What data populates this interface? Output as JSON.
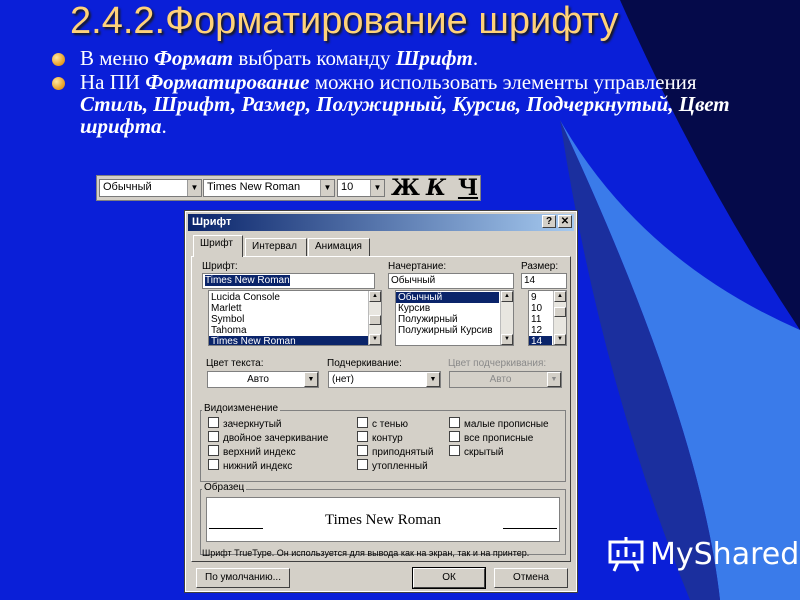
{
  "slide": {
    "title": "2.4.2.Форматирование шрифту",
    "bullet1": {
      "t1": "В меню ",
      "b1": "Формат",
      "t2": " выбрать команду ",
      "b2": "Шрифт",
      "t3": "."
    },
    "bullet2": {
      "t1": "На ПИ ",
      "b1": "Форматирование",
      "t2": " можно использовать элементы управления ",
      "b2": "Стиль, Шрифт, Размер, Полужирный, Курсив, Подчеркнутый, Цвет шрифта",
      "t3": "."
    }
  },
  "toolbar": {
    "style": "Обычный",
    "font": "Times New Roman",
    "size": "10",
    "bold": "Ж",
    "italic": "К",
    "underline": "Ч"
  },
  "dialog": {
    "title": "Шрифт",
    "help": "?",
    "close": "✕",
    "tabs": [
      "Шрифт",
      "Интервал",
      "Анимация"
    ],
    "font_label": "Шрифт:",
    "font_value": "Times New Roman",
    "font_list": [
      "Lucida Console",
      "Marlett",
      "Symbol",
      "Tahoma",
      "Times New Roman"
    ],
    "style_label": "Начертание:",
    "style_value": "Обычный",
    "style_list": [
      "Обычный",
      "Курсив",
      "Полужирный",
      "Полужирный Курсив"
    ],
    "size_label": "Размер:",
    "size_value": "14",
    "size_list": [
      "9",
      "10",
      "11",
      "12",
      "14"
    ],
    "color_label": "Цвет текста:",
    "color_value": "Авто",
    "underline_label": "Подчеркивание:",
    "underline_value": "(нет)",
    "ucolor_label": "Цвет подчеркивания:",
    "ucolor_value": "Авто",
    "effects_label": "Видоизменение",
    "effects_col1": [
      "зачеркнутый",
      "двойное зачеркивание",
      "верхний индекс",
      "нижний индекс"
    ],
    "effects_col2": [
      "с тенью",
      "контур",
      "приподнятый",
      "утопленный"
    ],
    "effects_col3": [
      "малые прописные",
      "все прописные",
      "скрытый"
    ],
    "sample_label": "Образец",
    "sample_text": "Times New Roman",
    "truetype_note": "Шрифт TrueType. Он используется для вывода как на экран, так и на принтер.",
    "default_btn": "По умолчанию...",
    "ok_btn": "ОК",
    "cancel_btn": "Отмена"
  },
  "watermark": "MyShared",
  "colors": {
    "background": "#0a1fd8",
    "title": "#ffd27a",
    "accent": "#3a7bea"
  }
}
